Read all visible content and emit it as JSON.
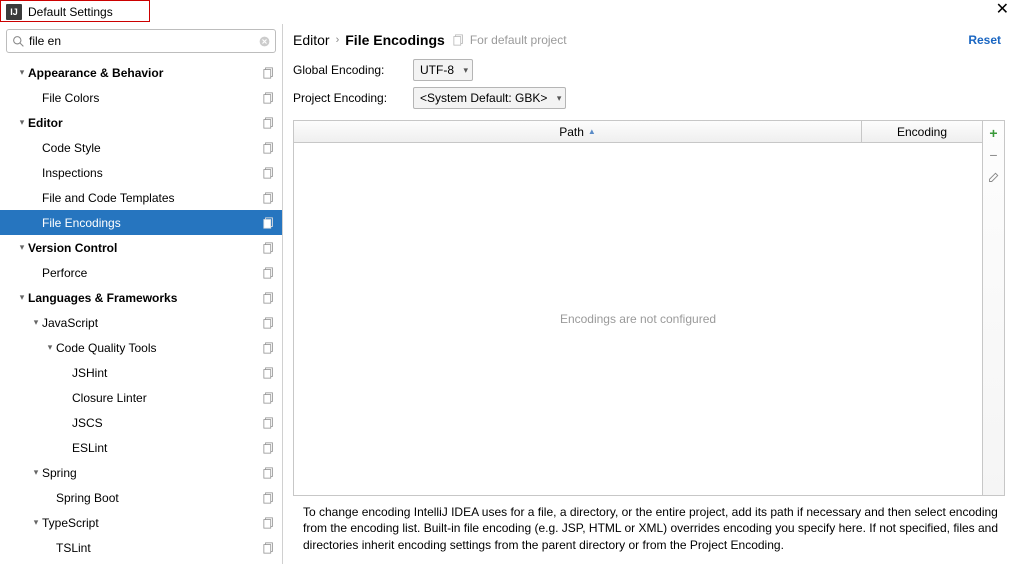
{
  "window": {
    "title": "Default Settings"
  },
  "search": {
    "value": "file en"
  },
  "tree": [
    {
      "label": "Appearance & Behavior",
      "depth": 0,
      "bold": true,
      "expandable": true,
      "copy": true
    },
    {
      "label": "File Colors",
      "depth": 1,
      "bold": false,
      "expandable": false,
      "copy": true
    },
    {
      "label": "Editor",
      "depth": 0,
      "bold": true,
      "expandable": true,
      "copy": true
    },
    {
      "label": "Code Style",
      "depth": 1,
      "bold": false,
      "expandable": false,
      "copy": true
    },
    {
      "label": "Inspections",
      "depth": 1,
      "bold": false,
      "expandable": false,
      "copy": true
    },
    {
      "label": "File and Code Templates",
      "depth": 1,
      "bold": false,
      "expandable": false,
      "copy": true
    },
    {
      "label": "File Encodings",
      "depth": 1,
      "bold": false,
      "expandable": false,
      "copy": true,
      "selected": true
    },
    {
      "label": "Version Control",
      "depth": 0,
      "bold": true,
      "expandable": true,
      "copy": true
    },
    {
      "label": "Perforce",
      "depth": 1,
      "bold": false,
      "expandable": false,
      "copy": true
    },
    {
      "label": "Languages & Frameworks",
      "depth": 0,
      "bold": true,
      "expandable": true,
      "copy": true
    },
    {
      "label": "JavaScript",
      "depth": 1,
      "bold": false,
      "expandable": true,
      "copy": true
    },
    {
      "label": "Code Quality Tools",
      "depth": 2,
      "bold": false,
      "expandable": true,
      "copy": true
    },
    {
      "label": "JSHint",
      "depth": 3,
      "bold": false,
      "expandable": false,
      "copy": true
    },
    {
      "label": "Closure Linter",
      "depth": 3,
      "bold": false,
      "expandable": false,
      "copy": true
    },
    {
      "label": "JSCS",
      "depth": 3,
      "bold": false,
      "expandable": false,
      "copy": true
    },
    {
      "label": "ESLint",
      "depth": 3,
      "bold": false,
      "expandable": false,
      "copy": true
    },
    {
      "label": "Spring",
      "depth": 1,
      "bold": false,
      "expandable": true,
      "copy": true
    },
    {
      "label": "Spring Boot",
      "depth": 2,
      "bold": false,
      "expandable": false,
      "copy": true
    },
    {
      "label": "TypeScript",
      "depth": 1,
      "bold": false,
      "expandable": true,
      "copy": true
    },
    {
      "label": "TSLint",
      "depth": 2,
      "bold": false,
      "expandable": false,
      "copy": true
    }
  ],
  "breadcrumb": {
    "root": "Editor",
    "leaf": "File Encodings",
    "hint": "For default project"
  },
  "actions": {
    "reset": "Reset"
  },
  "form": {
    "global_label": "Global Encoding:",
    "global_value": "UTF-8",
    "project_label": "Project Encoding:",
    "project_value": "<System Default: GBK>"
  },
  "table": {
    "col_path": "Path",
    "col_encoding": "Encoding",
    "empty_msg": "Encodings are not configured"
  },
  "hint": "To change encoding IntelliJ IDEA uses for a file, a directory, or the entire project, add its path if necessary and then select encoding from the encoding list. Built-in file encoding (e.g. JSP, HTML or XML) overrides encoding you specify here. If not specified, files and directories inherit encoding settings from the parent directory or from the Project Encoding."
}
